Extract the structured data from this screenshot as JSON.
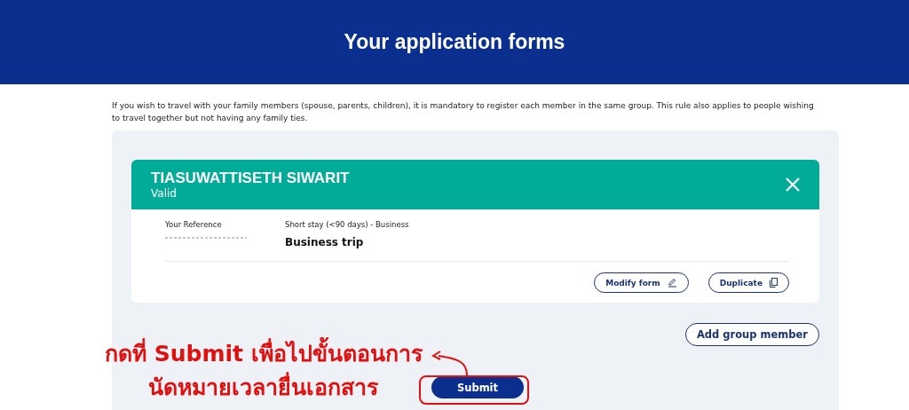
{
  "header": {
    "title": "Your application forms"
  },
  "notice": "If you wish to travel with your family members (spouse, parents, children), it is mandatory to register each member in the same group. This rule also applies to people wishing to travel together but not having any family ties.",
  "application": {
    "name": "TIASUWATTISETH SIWARIT",
    "status": "Valid",
    "reference_label": "Your Reference",
    "stay_type": "Short stay (<90 days) - Business",
    "purpose": "Business trip",
    "actions": [
      {
        "label": "Modify form",
        "kind": "edit"
      },
      {
        "label": "Duplicate",
        "kind": "copy"
      }
    ]
  },
  "add_member_button": "Add group member",
  "submit_button": "Submit",
  "annotation": {
    "lines": [
      "กดที่ Submit เพื่อไปขั้นตอนการ",
      "นัดหมายเวลายื่นเอกสาร"
    ]
  }
}
